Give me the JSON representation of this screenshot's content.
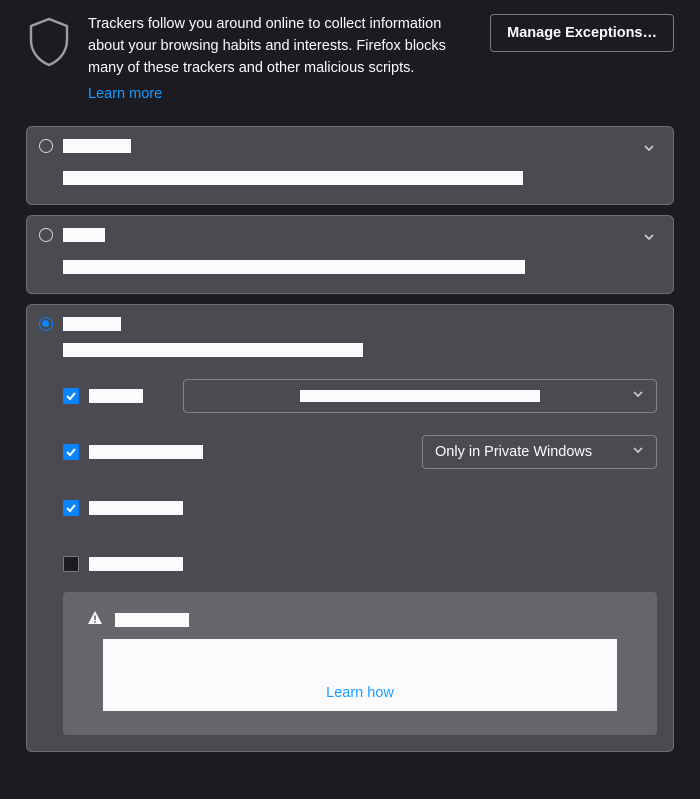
{
  "header": {
    "description": "Trackers follow you around online to collect information about your browsing habits and interests. Firefox blocks many of these trackers and other malicious scripts.",
    "learn_more": "Learn more",
    "manage_exceptions": "Manage Exceptions…"
  },
  "panels": [
    {
      "selected": false,
      "label_w": 68,
      "desc_w": 460
    },
    {
      "selected": false,
      "label_w": 42,
      "desc_w": 462
    },
    {
      "selected": true,
      "label_w": 58,
      "desc_w": 300
    }
  ],
  "custom": {
    "options": [
      {
        "checked": true,
        "label_w": 54,
        "select": {
          "kind": "wide",
          "value_ph_w": 240
        }
      },
      {
        "checked": true,
        "label_w": 114,
        "select": {
          "kind": "narrow",
          "value": "Only in Private Windows"
        }
      },
      {
        "checked": true,
        "label_w": 94
      },
      {
        "checked": false,
        "label_w": 94
      }
    ],
    "warning": {
      "title_w": 74,
      "learn_how": "Learn how"
    }
  }
}
